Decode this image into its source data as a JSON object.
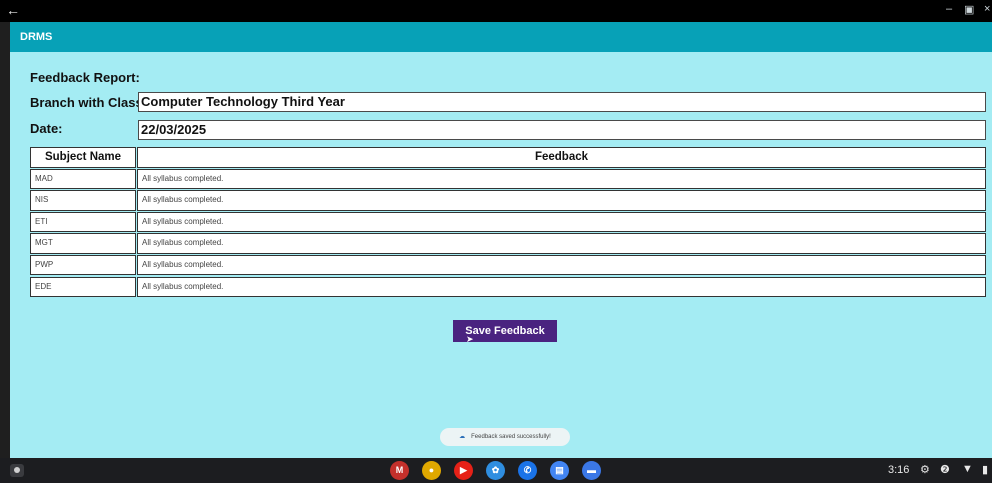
{
  "titlebar": {
    "back_icon": "←",
    "minimize_icon": "–",
    "maximize_icon": "▣",
    "close_icon": "×"
  },
  "app": {
    "title": "DRMS"
  },
  "form": {
    "heading": "Feedback Report:",
    "branch_label": "Branch with Class:",
    "branch_value": "Computer Technology Third Year",
    "date_label": "Date:",
    "date_value": "22/03/2025"
  },
  "table": {
    "headers": [
      "Subject Name",
      "Feedback"
    ],
    "rows": [
      {
        "subject": "MAD",
        "feedback": "All syllabus completed."
      },
      {
        "subject": "NIS",
        "feedback": "All syllabus completed."
      },
      {
        "subject": "ETI",
        "feedback": "All syllabus completed."
      },
      {
        "subject": "MGT",
        "feedback": "All syllabus completed."
      },
      {
        "subject": "PWP",
        "feedback": "All syllabus completed."
      },
      {
        "subject": "EDE",
        "feedback": "All syllabus completed."
      }
    ]
  },
  "actions": {
    "save_label": "Save Feedback",
    "cursor_icon": "➤"
  },
  "toast": {
    "icon": "☁",
    "message": "Feedback saved successfully!"
  },
  "taskbar": {
    "apps": [
      {
        "name": "gmail-icon",
        "glyph": "M",
        "color": "#c4302b"
      },
      {
        "name": "chrome-icon",
        "glyph": "●",
        "color": "#e0a800"
      },
      {
        "name": "youtube-icon",
        "glyph": "▶",
        "color": "#e62117"
      },
      {
        "name": "photos-icon",
        "glyph": "✿",
        "color": "#2f8ee0"
      },
      {
        "name": "phone-icon",
        "glyph": "✆",
        "color": "#1a73e8"
      },
      {
        "name": "messages-icon",
        "glyph": "▤",
        "color": "#4285f4"
      },
      {
        "name": "chat-icon",
        "glyph": "▬",
        "color": "#3b78e7"
      }
    ],
    "clock": "3:16",
    "settings_icon": "⚙",
    "notification_icon": "❷",
    "wifi_icon": "▼",
    "battery_icon": "▮"
  }
}
